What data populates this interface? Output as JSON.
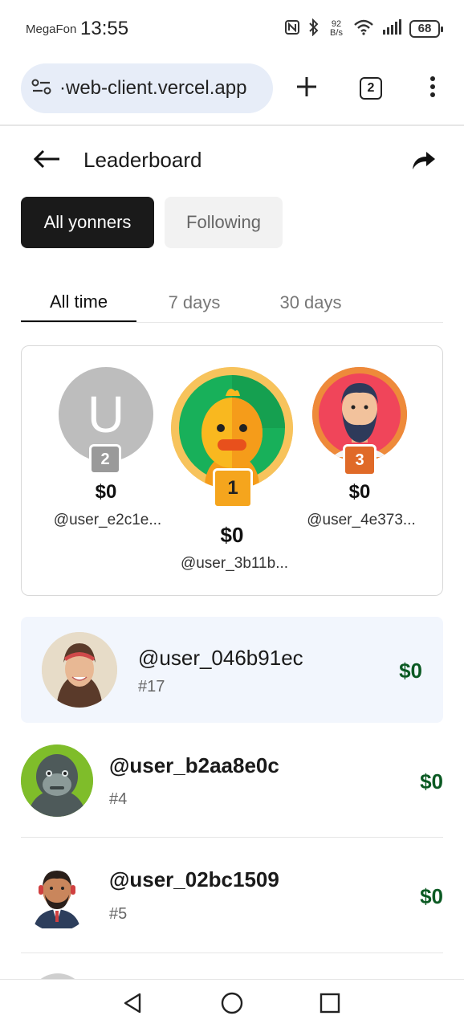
{
  "status": {
    "carrier": "MegaFon",
    "time": "13:55",
    "net_speed_value": "92",
    "net_speed_unit": "B/s",
    "battery": "68"
  },
  "browser": {
    "url": "·web-client.vercel.app",
    "tab_count": "2"
  },
  "page": {
    "title": "Leaderboard"
  },
  "filters": [
    {
      "label": "All yonners",
      "active": true
    },
    {
      "label": "Following",
      "active": false
    }
  ],
  "time_tabs": [
    {
      "label": "All time",
      "active": true
    },
    {
      "label": "7 days",
      "active": false
    },
    {
      "label": "30 days",
      "active": false
    }
  ],
  "podium": {
    "first": {
      "rank": "1",
      "amount": "$0",
      "username": "@user_3b11b..."
    },
    "second": {
      "rank": "2",
      "amount": "$0",
      "username": "@user_e2c1e...",
      "avatar_letter": "U"
    },
    "third": {
      "rank": "3",
      "amount": "$0",
      "username": "@user_4e373..."
    }
  },
  "current_user": {
    "username": "@user_046b91ec",
    "rank": "#17",
    "amount": "$0"
  },
  "rows": [
    {
      "username": "@user_b2aa8e0c",
      "rank": "#4",
      "amount": "$0"
    },
    {
      "username": "@user_02bc1509",
      "rank": "#5",
      "amount": "$0"
    }
  ],
  "colors": {
    "accent_dark": "#1a1a1a",
    "amount_green": "#0b5a23",
    "gold": "#f5a51d",
    "silver": "#9a9a9a",
    "bronze": "#e06a28",
    "highlight_bg": "#f2f6fd"
  },
  "icons": [
    "back-arrow-icon",
    "share-icon",
    "site-settings-icon",
    "plus-icon",
    "more-icon",
    "nfc-icon",
    "bluetooth-icon",
    "wifi-icon",
    "signal-icon",
    "battery-icon",
    "nav-back-icon",
    "nav-home-icon",
    "nav-recents-icon"
  ]
}
